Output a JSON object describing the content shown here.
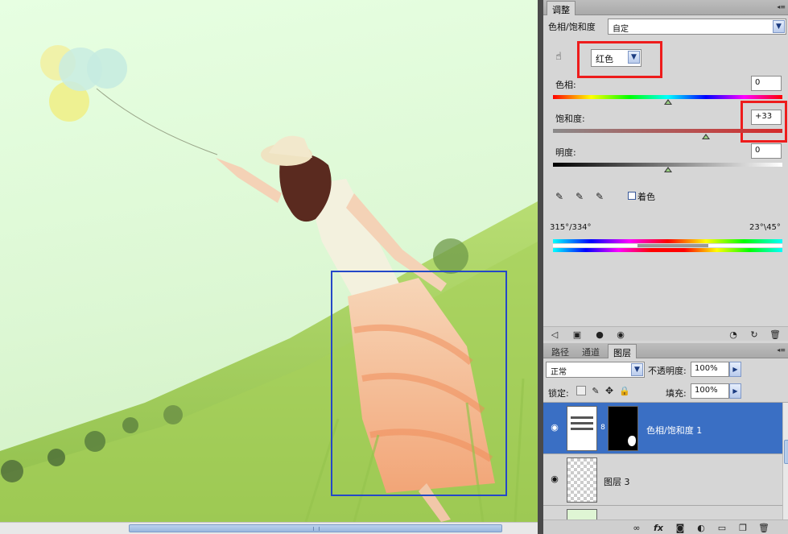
{
  "adjustments": {
    "tab_label": "调整",
    "panel_title": "色相/饱和度",
    "preset_value": "自定",
    "channel_value": "红色",
    "hue_label": "色相:",
    "hue_value": "0",
    "saturation_label": "饱和度:",
    "saturation_value": "+33",
    "lightness_label": "明度:",
    "lightness_value": "0",
    "colorize_label": "着色",
    "range_left": "315°/334°",
    "range_right": "23°\\45°"
  },
  "layers_panel": {
    "tabs": [
      "路径",
      "通道",
      "图层"
    ],
    "active_tab": "图层",
    "blend_mode": "正常",
    "opacity_label": "不透明度:",
    "opacity_value": "100%",
    "lock_label": "锁定:",
    "fill_label": "填充:",
    "fill_value": "100%",
    "layers": [
      {
        "name": "色相/饱和度 1",
        "selected": true
      },
      {
        "name": "图层 3",
        "selected": false
      }
    ]
  },
  "colors": {
    "selection_outline": "#2448c8",
    "highlight_box": "#ee1c1c",
    "selected_layer": "#3a6fc4"
  },
  "icons": [
    "hand-target-icon",
    "eyedropper-icon",
    "eyedropper-plus-icon",
    "eyedropper-minus-icon",
    "eye-icon",
    "link-icon",
    "fx-icon",
    "mask-icon",
    "adjustment-icon",
    "folder-icon",
    "new-layer-icon",
    "trash-icon",
    "reset-icon",
    "clip-icon"
  ]
}
